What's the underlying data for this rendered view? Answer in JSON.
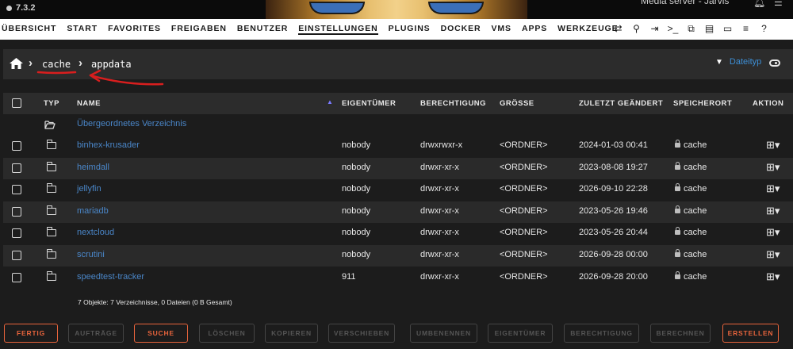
{
  "header": {
    "version": "7.3.2",
    "server_text": "Media server - Jarvis"
  },
  "nav": {
    "items": [
      {
        "label": "ÜBERSICHT",
        "active": false
      },
      {
        "label": "START",
        "active": false
      },
      {
        "label": "FAVORITES",
        "active": false
      },
      {
        "label": "FREIGABEN",
        "active": false
      },
      {
        "label": "BENUTZER",
        "active": false
      },
      {
        "label": "EINSTELLUNGEN",
        "active": true
      },
      {
        "label": "PLUGINS",
        "active": false
      },
      {
        "label": "DOCKER",
        "active": false
      },
      {
        "label": "VMS",
        "active": false
      },
      {
        "label": "APPS",
        "active": false
      },
      {
        "label": "WERKZEUGE",
        "active": false
      }
    ],
    "icons": [
      "sync-icon",
      "search-icon",
      "logout-icon",
      "terminal-icon",
      "copy-icon",
      "feedback-icon",
      "monitor-icon",
      "log-icon",
      "help-icon"
    ]
  },
  "breadcrumb": {
    "parts": [
      "cache",
      "appdata"
    ]
  },
  "toolbar": {
    "filter_label": "Dateityp"
  },
  "table": {
    "headers": {
      "typ": "TYP",
      "name": "NAME",
      "owner": "EIGENTÜMER",
      "permission": "BERECHTIGUNG",
      "size": "GRÖSSE",
      "modified": "ZULETZT GEÄNDERT",
      "location": "SPEICHERORT",
      "action": "AKTION"
    },
    "parent_label": "Übergeordnetes Verzeichnis",
    "rows": [
      {
        "name": "binhex-krusader",
        "owner": "nobody",
        "perm": "drwxrwxr-x",
        "size": "<ORDNER>",
        "modified": "2024-01-03 00:41",
        "location": "cache"
      },
      {
        "name": "heimdall",
        "owner": "nobody",
        "perm": "drwxr-xr-x",
        "size": "<ORDNER>",
        "modified": "2023-08-08 19:27",
        "location": "cache"
      },
      {
        "name": "jellyfin",
        "owner": "nobody",
        "perm": "drwxr-xr-x",
        "size": "<ORDNER>",
        "modified": "2026-09-10 22:28",
        "location": "cache"
      },
      {
        "name": "mariadb",
        "owner": "nobody",
        "perm": "drwxr-xr-x",
        "size": "<ORDNER>",
        "modified": "2023-05-26 19:46",
        "location": "cache"
      },
      {
        "name": "nextcloud",
        "owner": "nobody",
        "perm": "drwxr-xr-x",
        "size": "<ORDNER>",
        "modified": "2023-05-26 20:44",
        "location": "cache"
      },
      {
        "name": "scrutini",
        "owner": "nobody",
        "perm": "drwxr-xr-x",
        "size": "<ORDNER>",
        "modified": "2026-09-28 00:00",
        "location": "cache"
      },
      {
        "name": "speedtest-tracker",
        "owner": "911",
        "perm": "drwxr-xr-x",
        "size": "<ORDNER>",
        "modified": "2026-09-28 20:00",
        "location": "cache"
      }
    ],
    "summary": "7 Objekte: 7 Verzeichnisse, 0 Dateien (0 B Gesamt)"
  },
  "buttons": [
    {
      "label": "FERTIG",
      "enabled": true
    },
    {
      "label": "AUFTRÄGE",
      "enabled": false
    },
    {
      "label": "SUCHE",
      "enabled": true
    },
    {
      "label": "LÖSCHEN",
      "enabled": false
    },
    {
      "label": "KOPIEREN",
      "enabled": false
    },
    {
      "label": "VERSCHIEBEN",
      "enabled": false
    },
    {
      "label": "UMBENENNEN",
      "enabled": false
    },
    {
      "label": "EIGENTÜMER",
      "enabled": false
    },
    {
      "label": "BERECHTIGUNG",
      "enabled": false
    },
    {
      "label": "BERECHNEN",
      "enabled": false
    },
    {
      "label": "ERSTELLEN",
      "enabled": true
    }
  ],
  "colors": {
    "accent_orange": "#e8643c",
    "link_blue": "#4a86c8",
    "annotation_red": "#d91e1e"
  }
}
